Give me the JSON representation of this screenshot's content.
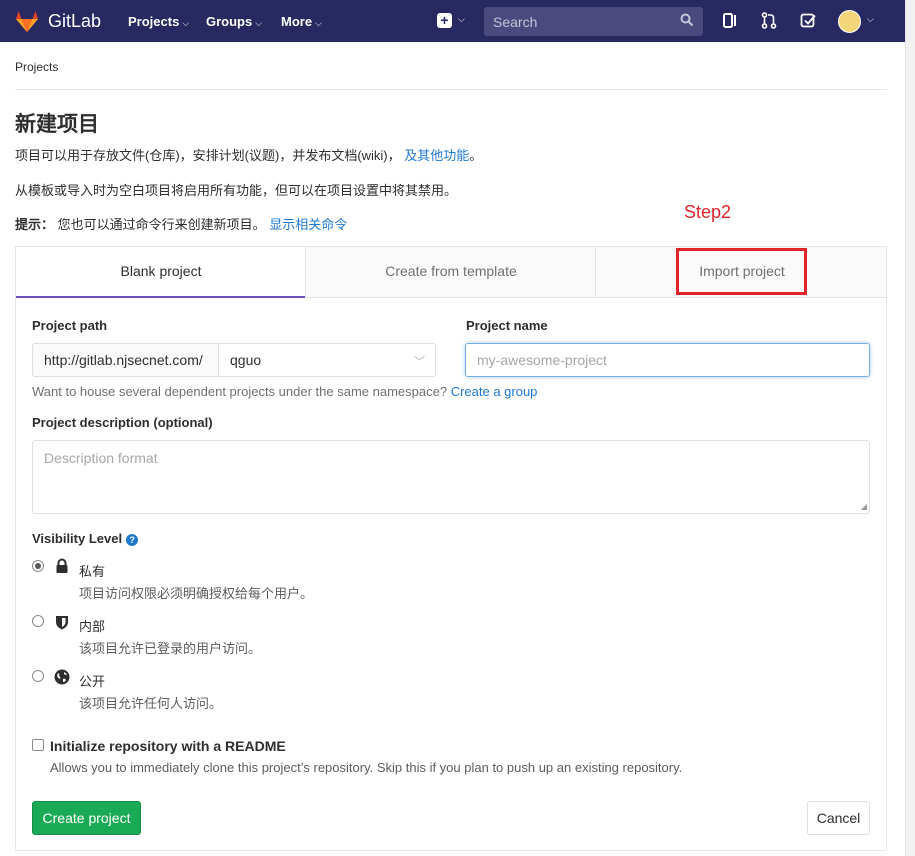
{
  "navbar": {
    "brand": "GitLab",
    "menus": [
      {
        "label": "Projects"
      },
      {
        "label": "Groups"
      },
      {
        "label": "More"
      }
    ],
    "search_placeholder": "Search",
    "bg_color": "#292961"
  },
  "breadcrumb": "Projects",
  "page": {
    "title": "新建项目",
    "intro_text": "项目可以用于存放文件(仓库)，安排计划(议题)，并发布文档(wiki)，",
    "intro_link": "及其他功能",
    "intro_end": "。",
    "template_note": "从模板或导入时为空白项目将启用所有功能，但可以在项目设置中将其禁用。",
    "tip_label": "提示：",
    "tip_text": "您也可以通过命令行来创建新项目。",
    "tip_link": "显示相关命令"
  },
  "annotation": {
    "step_label": "Step2",
    "color": "#e0262b"
  },
  "tabs": [
    {
      "label": "Blank project",
      "active": true
    },
    {
      "label": "Create from template",
      "active": false
    },
    {
      "label": "Import project",
      "active": false
    }
  ],
  "form": {
    "project_path_label": "Project path",
    "project_path_prefix": "http://gitlab.njsecnet.com/",
    "namespace_value": "qguo",
    "project_name_label": "Project name",
    "project_name_placeholder": "my-awesome-project",
    "group_hint": "Want to house several dependent projects under the same namespace?",
    "group_hint_link": "Create a group",
    "description_label": "Project description (optional)",
    "description_placeholder": "Description format",
    "visibility_label": "Visibility Level",
    "visibility_options": [
      {
        "title": "私有",
        "desc": "项目访问权限必须明确授权给每个用户。",
        "checked": true,
        "icon": "lock-icon"
      },
      {
        "title": "内部",
        "desc": "该项目允许已登录的用户访问。",
        "checked": false,
        "icon": "shield-icon"
      },
      {
        "title": "公开",
        "desc": "该项目允许任何人访问。",
        "checked": false,
        "icon": "globe-icon"
      }
    ],
    "readme_label": "Initialize repository with a README",
    "readme_desc": "Allows you to immediately clone this project’s repository. Skip this if you plan to push up an existing repository.",
    "create_button": "Create project",
    "cancel_button": "Cancel"
  }
}
